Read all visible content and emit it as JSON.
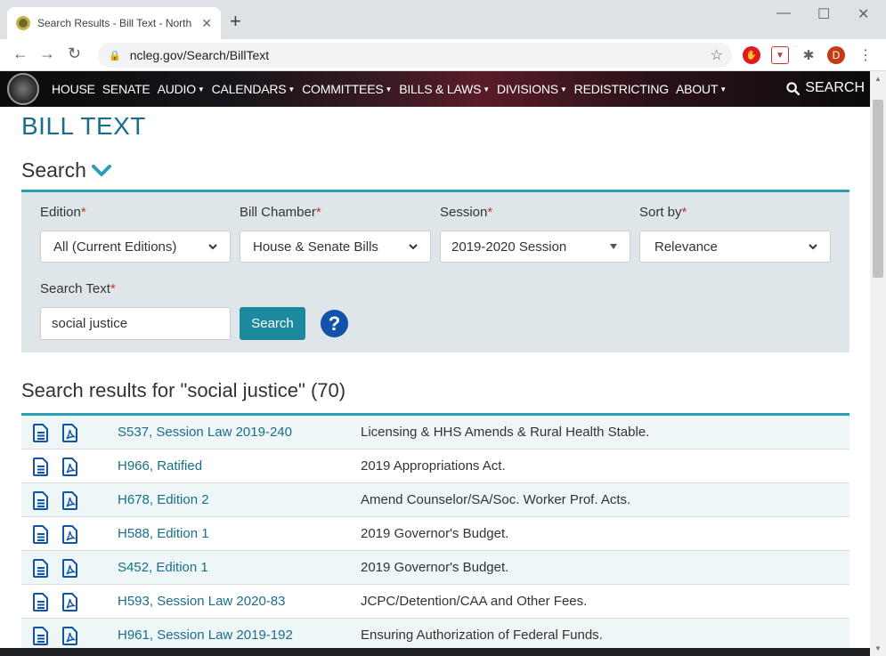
{
  "browser": {
    "tab_title": "Search Results - Bill Text - North",
    "tab_close": "✕",
    "new_tab": "+",
    "url": "ncleg.gov/Search/BillText",
    "profile_initial": "D"
  },
  "site_nav": {
    "items": [
      {
        "label": "HOUSE",
        "dropdown": false
      },
      {
        "label": "SENATE",
        "dropdown": false
      },
      {
        "label": "AUDIO",
        "dropdown": true
      },
      {
        "label": "CALENDARS",
        "dropdown": true
      },
      {
        "label": "COMMITTEES",
        "dropdown": true
      },
      {
        "label": "BILLS & LAWS",
        "dropdown": true
      },
      {
        "label": "DIVISIONS",
        "dropdown": true
      },
      {
        "label": "REDISTRICTING",
        "dropdown": false
      },
      {
        "label": "ABOUT",
        "dropdown": true
      }
    ],
    "search_label": "SEARCH"
  },
  "page": {
    "title": "BILL TEXT",
    "search_heading": "Search"
  },
  "form": {
    "edition": {
      "label": "Edition",
      "value": "All (Current Editions)"
    },
    "chamber": {
      "label": "Bill Chamber",
      "value": "House & Senate Bills"
    },
    "session": {
      "label": "Session",
      "value": "2019-2020 Session"
    },
    "sort": {
      "label": "Sort by",
      "value": "Relevance"
    },
    "search_text": {
      "label": "Search Text",
      "value": "social justice"
    },
    "required_mark": "*",
    "search_button": "Search",
    "help_glyph": "?"
  },
  "results": {
    "heading": "Search results for \"social justice\" (70)",
    "rows": [
      {
        "bill": "S537, Session Law 2019-240",
        "description": "Licensing & HHS Amends & Rural Health Stable."
      },
      {
        "bill": "H966, Ratified",
        "description": "2019 Appropriations Act."
      },
      {
        "bill": "H678, Edition 2",
        "description": "Amend Counselor/SA/Soc. Worker Prof. Acts."
      },
      {
        "bill": "H588, Edition 1",
        "description": "2019 Governor's Budget."
      },
      {
        "bill": "S452, Edition 1",
        "description": "2019 Governor's Budget."
      },
      {
        "bill": "H593, Session Law 2020-83",
        "description": "JCPC/Detention/CAA and Other Fees."
      },
      {
        "bill": "H961, Session Law 2019-192",
        "description": "Ensuring Authorization of Federal Funds."
      }
    ]
  },
  "colors": {
    "accent": "#2a9fb0",
    "link": "#1a6e8a",
    "button": "#1c8a9e",
    "help": "#1153a8"
  }
}
